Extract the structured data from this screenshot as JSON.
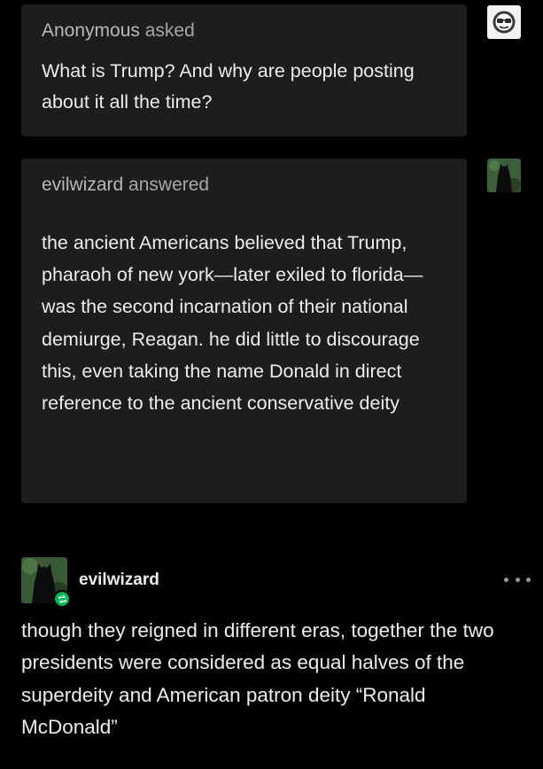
{
  "ask": {
    "asker": "Anonymous",
    "verb": "asked",
    "question": "What is Trump? And why are people posting about it all the time?"
  },
  "answer": {
    "answerer": "evilwizard",
    "verb": "answered",
    "text": "the ancient Americans believed that Trump, pharaoh of new york—later exiled to florida—was the second incarnation of their national demiurge, Reagan. he did little to discourage this, even taking the name Donald in direct reference to the ancient conservative deity"
  },
  "reblog": {
    "username": "evilwizard",
    "text": "though they reigned in different eras, together the two presidents were considered as equal halves of the superdeity and American patron deity “Ronald McDonald”"
  },
  "icons": {
    "anon_avatar": "sunglasses-face-icon",
    "wizard_avatar": "dark-wizard-avatar",
    "reblog_badge": "reblog-icon",
    "more": "more-horizontal-icon"
  },
  "colors": {
    "background": "#000000",
    "bubble": "#1d1d1d",
    "reblog_green": "#00b65c"
  }
}
